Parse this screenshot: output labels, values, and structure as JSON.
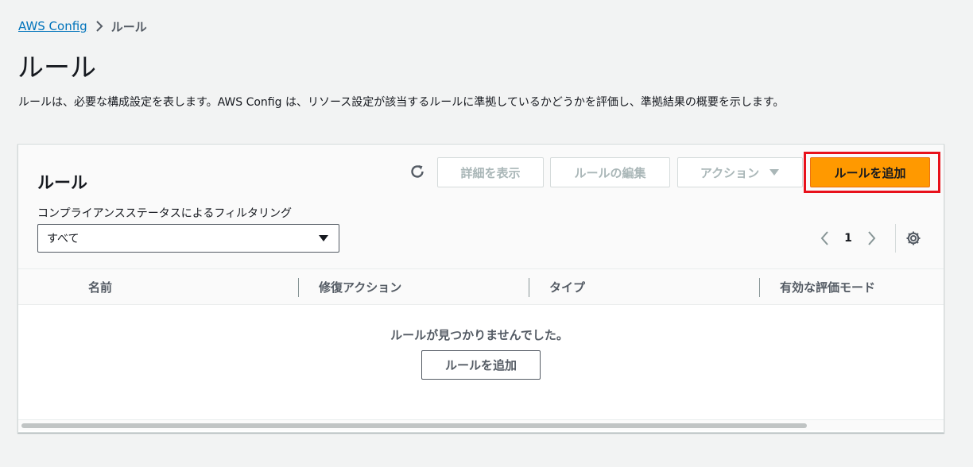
{
  "breadcrumb": {
    "root": "AWS Config",
    "current": "ルール"
  },
  "page": {
    "title": "ルール",
    "description": "ルールは、必要な構成設定を表します。AWS Config は、リソース設定が該当するルールに準拠しているかどうかを評価し、準拠結果の概要を示します。"
  },
  "panel": {
    "title": "ルール",
    "buttons": {
      "view_details": "詳細を表示",
      "edit_rule": "ルールの編集",
      "actions": "アクション",
      "add_rule": "ルールを追加"
    },
    "filter": {
      "label": "コンプライアンスステータスによるフィルタリング",
      "selected": "すべて"
    },
    "pagination": {
      "current_page": "1"
    }
  },
  "table": {
    "columns": [
      "名前",
      "修復アクション",
      "タイプ",
      "有効な評価モード"
    ]
  },
  "empty_state": {
    "message": "ルールが見つかりませんでした。",
    "button": "ルールを追加"
  },
  "colors": {
    "accent": "#ff9900",
    "link": "#0073bb",
    "highlight": "#e8111b"
  },
  "icons": {
    "refresh": "refresh-icon",
    "caret": "caret-down-icon",
    "pager_prev": "chevron-left-icon",
    "pager_next": "chevron-right-icon",
    "settings": "gear-icon"
  }
}
